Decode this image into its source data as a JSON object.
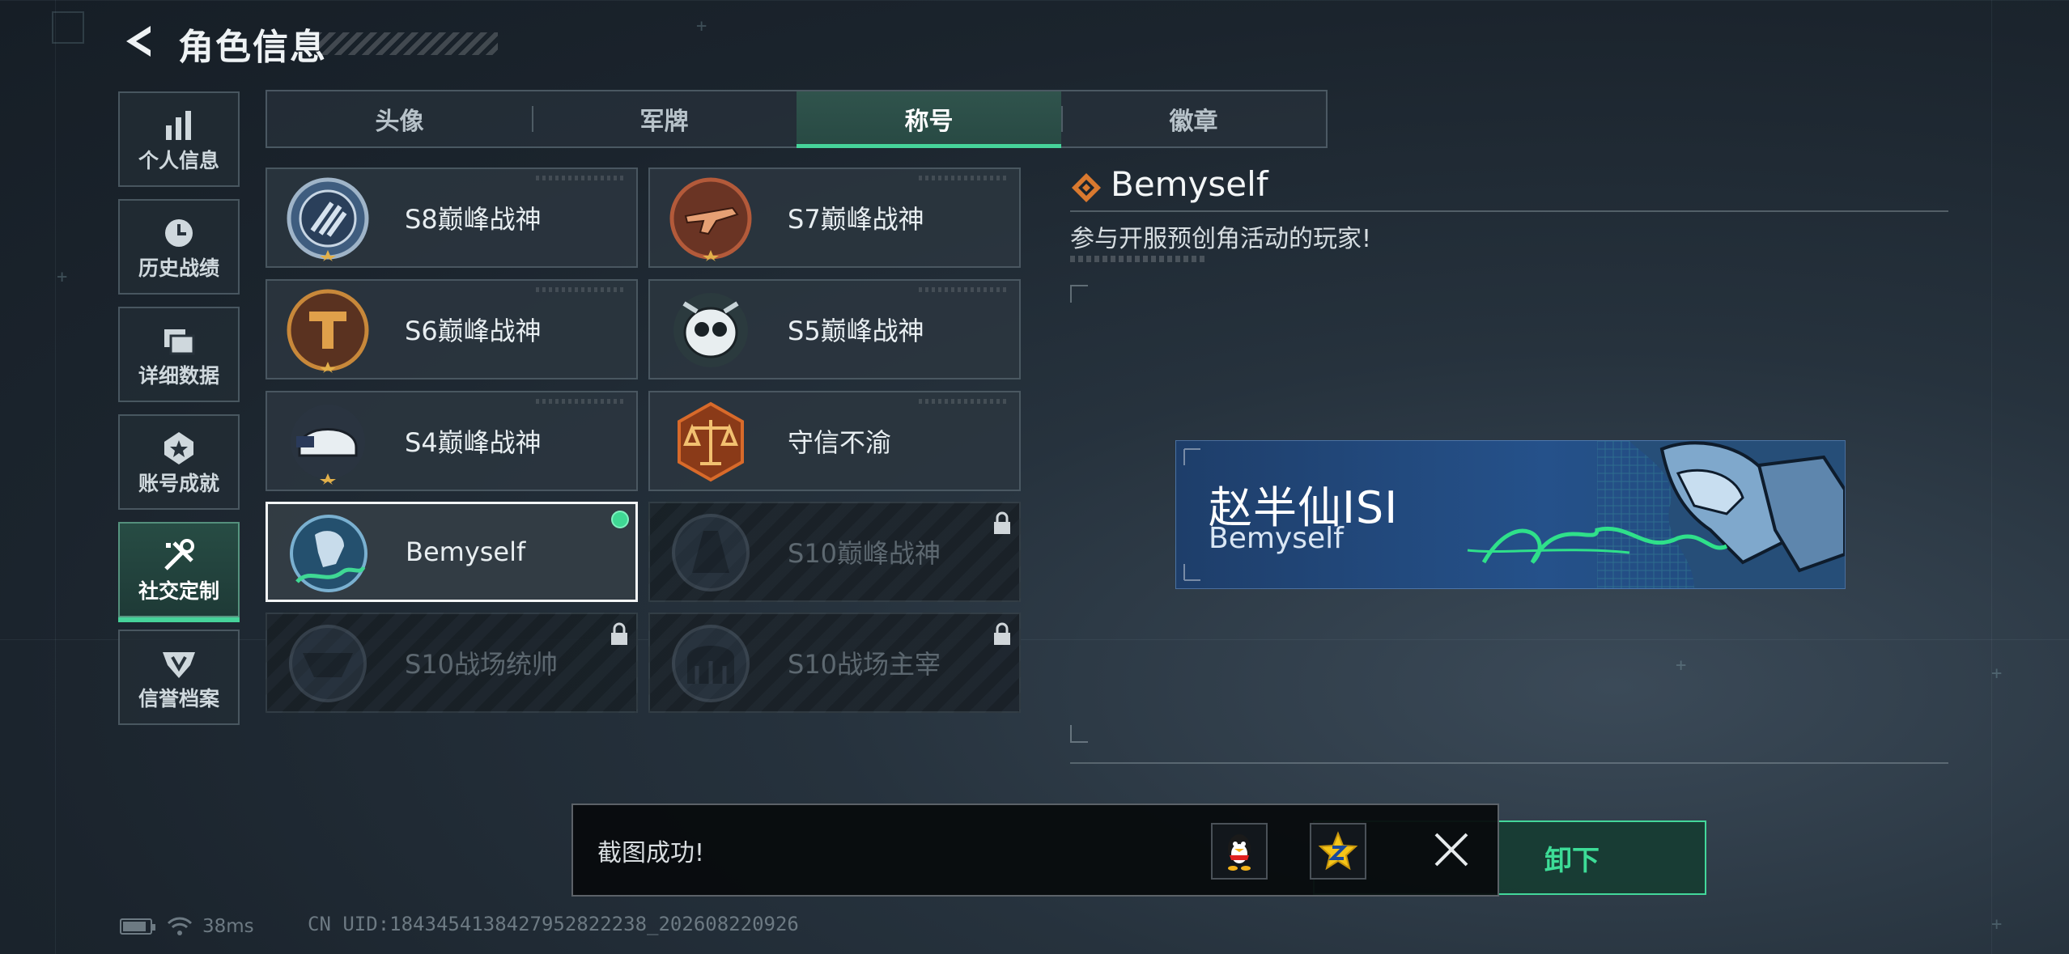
{
  "header": {
    "title": "角色信息"
  },
  "sidebar": {
    "items": [
      {
        "label": "个人信息",
        "icon": "bar-chart-icon",
        "active": false
      },
      {
        "label": "历史战绩",
        "icon": "clock-icon",
        "active": false
      },
      {
        "label": "详细数据",
        "icon": "folders-icon",
        "active": false
      },
      {
        "label": "账号成就",
        "icon": "medal-icon",
        "active": false
      },
      {
        "label": "社交定制",
        "icon": "tools-icon",
        "active": true
      },
      {
        "label": "信誉档案",
        "icon": "shield-wings-icon",
        "active": false
      }
    ]
  },
  "tabs": [
    {
      "label": "头像",
      "active": false
    },
    {
      "label": "军牌",
      "active": false
    },
    {
      "label": "称号",
      "active": true
    },
    {
      "label": "徽章",
      "active": false
    }
  ],
  "titles": [
    {
      "name": "S8巅峰战神",
      "emblem": "s8-emblem-icon",
      "state": "owned"
    },
    {
      "name": "S7巅峰战神",
      "emblem": "s7-emblem-icon",
      "state": "owned"
    },
    {
      "name": "S6巅峰战神",
      "emblem": "s6-emblem-icon",
      "state": "owned"
    },
    {
      "name": "S5巅峰战神",
      "emblem": "s5-emblem-icon",
      "state": "owned"
    },
    {
      "name": "S4巅峰战神",
      "emblem": "s4-emblem-icon",
      "state": "owned"
    },
    {
      "name": "守信不渝",
      "emblem": "scales-emblem-icon",
      "state": "owned"
    },
    {
      "name": "Bemyself",
      "emblem": "bemyself-emblem-icon",
      "state": "selected"
    },
    {
      "name": "S10巅峰战神",
      "emblem": "s10-emblem-icon",
      "state": "locked"
    },
    {
      "name": "S10战场统帅",
      "emblem": "s10-commander-emblem-icon",
      "state": "locked"
    },
    {
      "name": "S10战场主宰",
      "emblem": "s10-dominator-emblem-icon",
      "state": "locked"
    }
  ],
  "detail": {
    "name": "Bemyself",
    "description": "参与开服预创角活动的玩家!",
    "banner": {
      "player_name": "赵半仙ISI",
      "title": "Bemyself",
      "signature": "Bemyself"
    },
    "unequip_label": "卸下"
  },
  "toast": {
    "message": "截图成功!",
    "share_icons": [
      "qq-penguin-icon",
      "qzone-star-icon"
    ]
  },
  "status": {
    "ping": "38ms",
    "uid": "CN UID:1843454138427952822238_202608220926"
  },
  "colors": {
    "accent_green": "#46d39a",
    "background": "#1b242d",
    "banner_blue": "#25518a"
  }
}
